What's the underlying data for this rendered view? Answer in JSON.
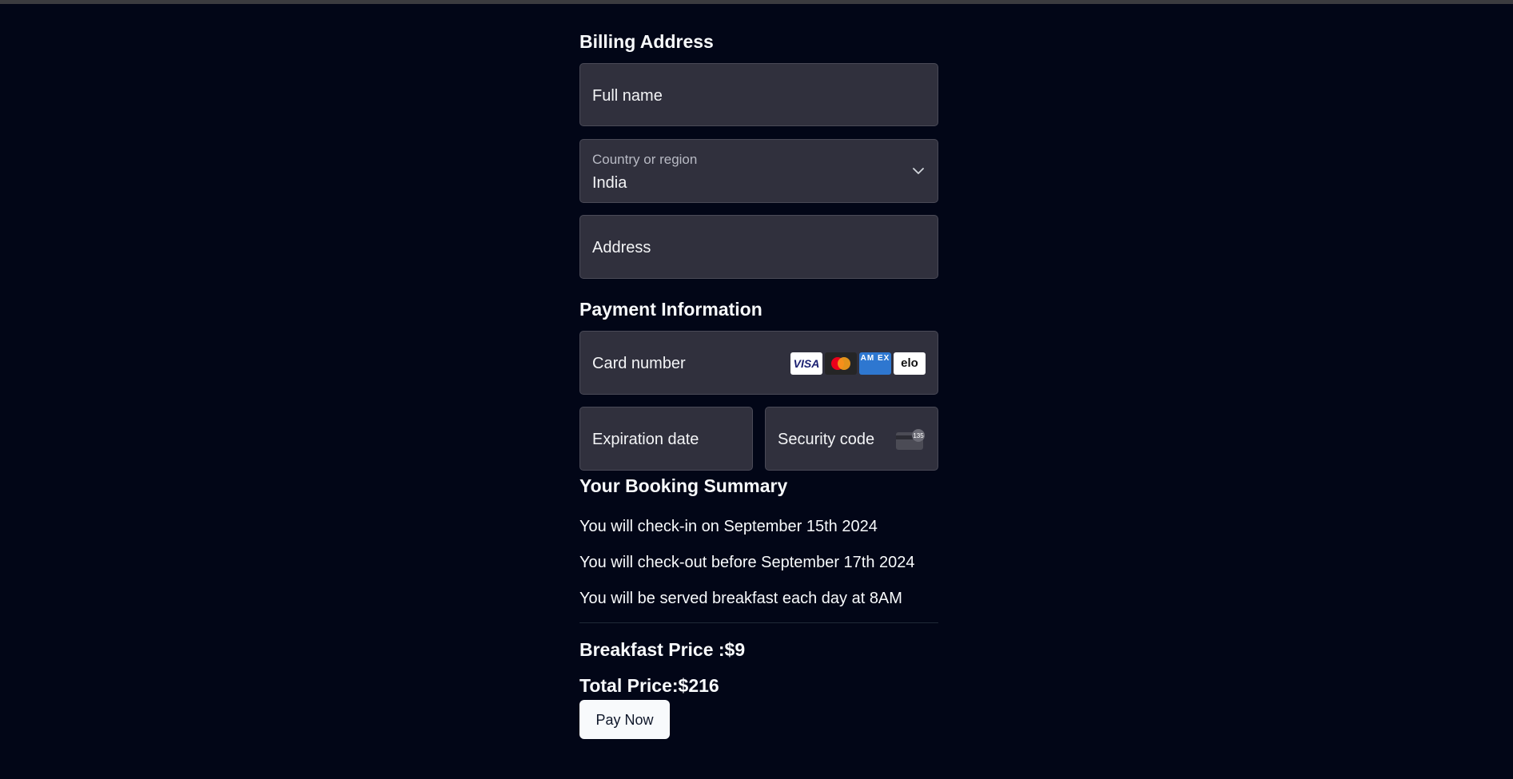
{
  "billing": {
    "heading": "Billing Address",
    "full_name_placeholder": "Full name",
    "country_label": "Country or region",
    "country_value": "India",
    "address_placeholder": "Address"
  },
  "payment": {
    "heading": "Payment Information",
    "card_number_placeholder": "Card number",
    "card_brands": [
      "visa",
      "mastercard",
      "amex",
      "elo"
    ],
    "visa_label": "VISA",
    "amex_label": "AM EX",
    "elo_label": "elo",
    "expiration_placeholder": "Expiration date",
    "security_placeholder": "Security code",
    "cvc_badge": "135"
  },
  "summary": {
    "heading": "Your Booking Summary",
    "checkin": "You will check-in on September 15th 2024",
    "checkout": "You will check-out before September 17th 2024",
    "breakfast": "You will be served breakfast each day at 8AM",
    "breakfast_price": "Breakfast Price :$9",
    "total_price": "Total Price:$216",
    "pay_button": "Pay Now"
  },
  "colors": {
    "background": "#020617",
    "field_bg": "#30303d",
    "button_bg": "#f8fafc"
  }
}
